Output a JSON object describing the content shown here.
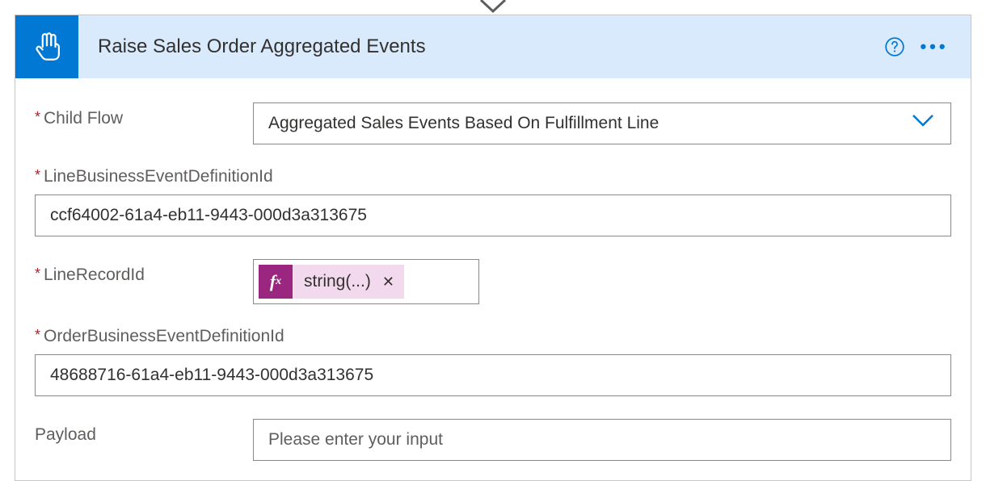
{
  "header": {
    "title": "Raise Sales Order Aggregated Events"
  },
  "fields": {
    "childFlow": {
      "label": "Child Flow",
      "value": "Aggregated Sales Events Based On Fulfillment Line",
      "required": true
    },
    "lineDefId": {
      "label": "LineBusinessEventDefinitionId",
      "value": "ccf64002-61a4-eb11-9443-000d3a313675",
      "required": true
    },
    "lineRecordId": {
      "label": "LineRecordId",
      "expression": "string(...)",
      "required": true
    },
    "orderDefId": {
      "label": "OrderBusinessEventDefinitionId",
      "value": "48688716-61a4-eb11-9443-000d3a313675",
      "required": true
    },
    "payload": {
      "label": "Payload",
      "placeholder": "Please enter your input",
      "required": false
    }
  },
  "colors": {
    "accent": "#0078d4",
    "headerBg": "#d9eafc",
    "requiredAsterisk": "#a4262c",
    "fxBg": "#9a2680",
    "tokenBg": "#f3d9ed",
    "border": "#8a8886",
    "labelText": "#605e5c"
  }
}
